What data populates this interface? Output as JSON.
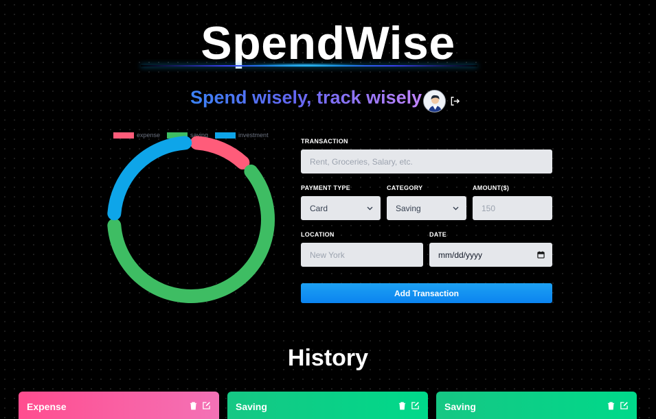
{
  "header": {
    "title": "SpendWise",
    "tagline": "Spend wisely, track wisely"
  },
  "chart_data": {
    "type": "pie",
    "style": "doughnut",
    "legend_position": "top",
    "categories": [
      "expense",
      "saving",
      "investment"
    ],
    "values": [
      13,
      62,
      25
    ],
    "colors": [
      "#ff5c7a",
      "#3ebd63",
      "#0ea5e9"
    ]
  },
  "form": {
    "transaction_label": "TRANSACTION",
    "transaction_placeholder": "Rent, Groceries, Salary, etc.",
    "payment_type_label": "PAYMENT TYPE",
    "payment_type_value": "Card",
    "category_label": "CATEGORY",
    "category_value": "Saving",
    "amount_label": "AMOUNT($)",
    "amount_placeholder": "150",
    "location_label": "LOCATION",
    "location_placeholder": "New York",
    "date_label": "DATE",
    "date_placeholder": "mm/dd/yyyy",
    "submit_label": "Add Transaction"
  },
  "history": {
    "title": "History",
    "cards": [
      {
        "category": "Expense",
        "color": "#ff4d8f"
      },
      {
        "category": "Saving",
        "color": "#16c784"
      },
      {
        "category": "Saving",
        "color": "#16c784"
      }
    ]
  },
  "icons": {
    "avatar": "user-avatar",
    "logout": "logout-icon",
    "delete": "trash-icon",
    "edit": "edit-icon",
    "dropdown": "chevron-down-icon",
    "calendar": "calendar-icon"
  }
}
